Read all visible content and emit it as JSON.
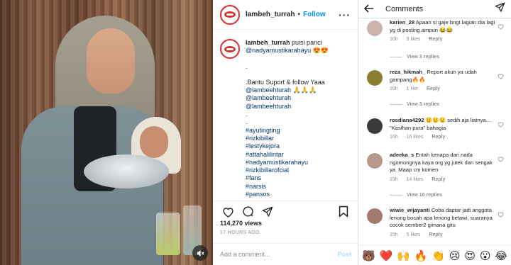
{
  "post": {
    "username": "lambeh_turrah",
    "follow_label": "Follow",
    "caption_user": "lambeh_turrah",
    "caption_text": "puisi panci",
    "caption_mention": "@nadyamustikarahayu",
    "caption_emoji": "😍😍",
    "dot1": ".",
    "support_line": ".Bantu Suport & follow Yaaa",
    "mentions": [
      "@lambeehturah 🙏🙏🙏",
      "@lambeehturah",
      "@lambeehturah"
    ],
    "dot2": ".",
    "dot3": ".",
    "hashtags": [
      "#ayutingting",
      "#rizkibillar",
      "#lestykejora",
      "#attahalilintar",
      "#nadyamustikarahayu",
      "#rizkibillarofcial",
      "#fans",
      "#narsis",
      "#pansos"
    ],
    "views": "114,270 views",
    "time_ago": "17 HOURS AGO",
    "add_comment_placeholder": "Add a comment...",
    "post_label": "Post"
  },
  "comments_panel": {
    "title": "Comments",
    "items": [
      {
        "user": "karien_28",
        "text": "Apaan si gaje bngt lagian dia lagi yg di posting ampun 😂😂",
        "time": "16h",
        "likes": "9 likes",
        "reply": "Reply",
        "view_replies": "View 3 replies",
        "avatar_color": "#c9b6a8"
      },
      {
        "user": "reza_hikmah_",
        "text": "Report akun ya udah gampang🔥🔥",
        "time": "16h",
        "likes": "1 like",
        "reply": "Reply",
        "view_replies": "View 3 replies",
        "avatar_color": "#8a7d2f"
      },
      {
        "user": "rosdiana4292",
        "text": "😟😟😟 sedih aja liatnya.... \"Kasihan pura\" bahagia",
        "time": "16h",
        "likes": "16 likes",
        "reply": "Reply",
        "view_replies": "",
        "avatar_color": "#3b3b3b"
      },
      {
        "user": "adeeka_s",
        "text": "Entah kenapa dari nada ngomongnya kaya org yg jutek dan sengak ya. Maap cm komen",
        "time": "15h",
        "likes": "14 likes",
        "reply": "Reply",
        "view_replies": "View 10 replies",
        "avatar_color": "#b49a8c"
      },
      {
        "user": "wiwie_wijayanti",
        "text": "Coba daptar jadi anggota lenong bocah apa lenong betawi, suaranya cocok sember2 gimana gitu",
        "time": "15h",
        "likes": "5 likes",
        "reply": "Reply",
        "view_replies": "",
        "avatar_color": "#a57a6e"
      }
    ],
    "emojis": [
      "🐻",
      "❤️",
      "🙌",
      "🔥",
      "👏",
      "😢",
      "😍",
      "😮",
      "😂"
    ]
  },
  "icons": {
    "video_mute": "mute-icon",
    "heart": "heart-icon",
    "comment": "comment-icon",
    "share": "share-icon",
    "save": "bookmark-icon",
    "back": "back-arrow-icon",
    "direct": "paper-plane-icon",
    "more": "more-icon"
  },
  "colors": {
    "follow": "#0095f6",
    "link": "#00376b",
    "brand_red": "#d62d2d"
  }
}
